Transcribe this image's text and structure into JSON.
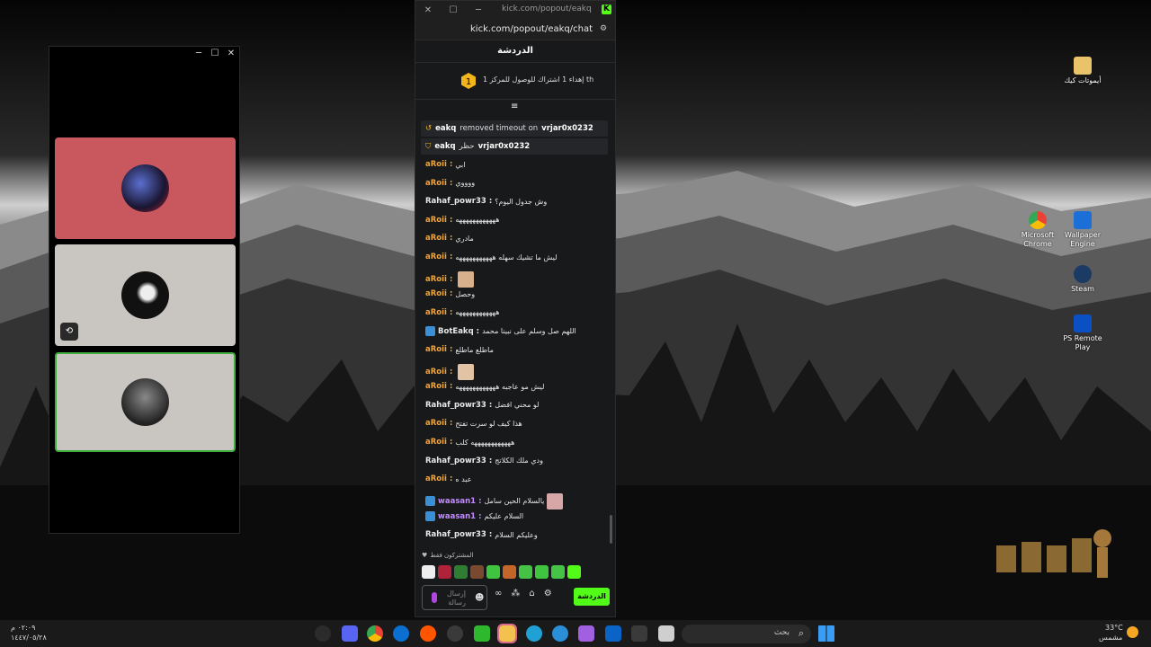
{
  "chat_window": {
    "title_url": "kick.com/popout/eakq/chat -...",
    "address": "kick.com/popout/eakq/chat",
    "header": "الدردشة",
    "goal": {
      "number": "1",
      "text": "إهداء 1 اشتراك للوصول للمركز 1 th"
    },
    "system_messages": [
      {
        "user": "eakq",
        "action": "removed timeout on",
        "target": "vrjar0x0232"
      },
      {
        "user": "eakq",
        "action": "حظر",
        "target": "vrjar0x0232"
      }
    ],
    "messages": [
      {
        "user": "aRoii",
        "sep": ":",
        "text": "ابي"
      },
      {
        "user": "aRoii",
        "sep": ":",
        "text": "ووووي"
      },
      {
        "user": "Rahaf_powr33",
        "sep": ":",
        "text": "وش جدول اليوم؟"
      },
      {
        "user": "aRoii",
        "sep": ":",
        "text": "ههههههههههههه"
      },
      {
        "user": "aRoii",
        "sep": ":",
        "text": "مادري"
      },
      {
        "user": "aRoii",
        "sep": ":",
        "text": "ليش ما تشيك سهله هههههههههههه"
      },
      {
        "user": "aRoii",
        "sep": ":",
        "text": ""
      },
      {
        "user": "aRoii",
        "sep": ":",
        "text": "وحصل"
      },
      {
        "user": "aRoii",
        "sep": ":",
        "text": "ههههههههههههه"
      },
      {
        "user": "BotEakq",
        "sep": ":",
        "text": "اللهم صل وسلم على نبينا محمد"
      },
      {
        "user": "aRoii",
        "sep": ":",
        "text": "ماطلع ماطلع"
      },
      {
        "user": "aRoii",
        "sep": ":",
        "text": ""
      },
      {
        "user": "aRoii",
        "sep": ":",
        "text": "ليش مو عاجبه ههههههههههههه"
      },
      {
        "user": "Rahaf_powr33",
        "sep": ":",
        "text": "لو محني افضل"
      },
      {
        "user": "aRoii",
        "sep": ":",
        "text": "هذا كيف لو سرت تفتح"
      },
      {
        "user": "aRoii",
        "sep": ":",
        "text": "ههههههههههههه كلب"
      },
      {
        "user": "Rahaf_powr33",
        "sep": ":",
        "text": "ودي ملك الكلاتج"
      },
      {
        "user": "aRoii",
        "sep": ":",
        "text": "عبد ه"
      },
      {
        "user": "waasan1",
        "sep": ":",
        "text": "يالسلام الحين سامل"
      },
      {
        "user": "waasan1",
        "sep": ":",
        "text": "السلام عليكم"
      },
      {
        "user": "Rahaf_powr33",
        "sep": ":",
        "text": "وعليكم السلام"
      }
    ],
    "subs_only": "المشتركون فقط",
    "input_placeholder": "إرسال رسالة",
    "send_label": "الدردشة"
  },
  "desktop_icons": [
    {
      "label": "أيموتات كيك"
    },
    {
      "label": "Microsoft Chrome"
    },
    {
      "label": "Wallpaper Engine"
    },
    {
      "label": "Steam"
    },
    {
      "label": "PS Remote Play"
    }
  ],
  "taskbar": {
    "search_placeholder": "بحث",
    "clock_time": "٠٢:٠٩ م",
    "clock_date": "١٤٤٧/٠٥/٢٨",
    "weather_temp": "33°C",
    "weather_cond": "مشمس"
  },
  "colors": {
    "kick_green": "#53fc18",
    "user_aroii": "#f0a43c",
    "user_rahaf": "#e8e8e8",
    "user_bot": "#e8e8e8",
    "user_waasan": "#c28cff",
    "tile_red": "#c8585e",
    "tile_grey": "#c9c6c1"
  }
}
